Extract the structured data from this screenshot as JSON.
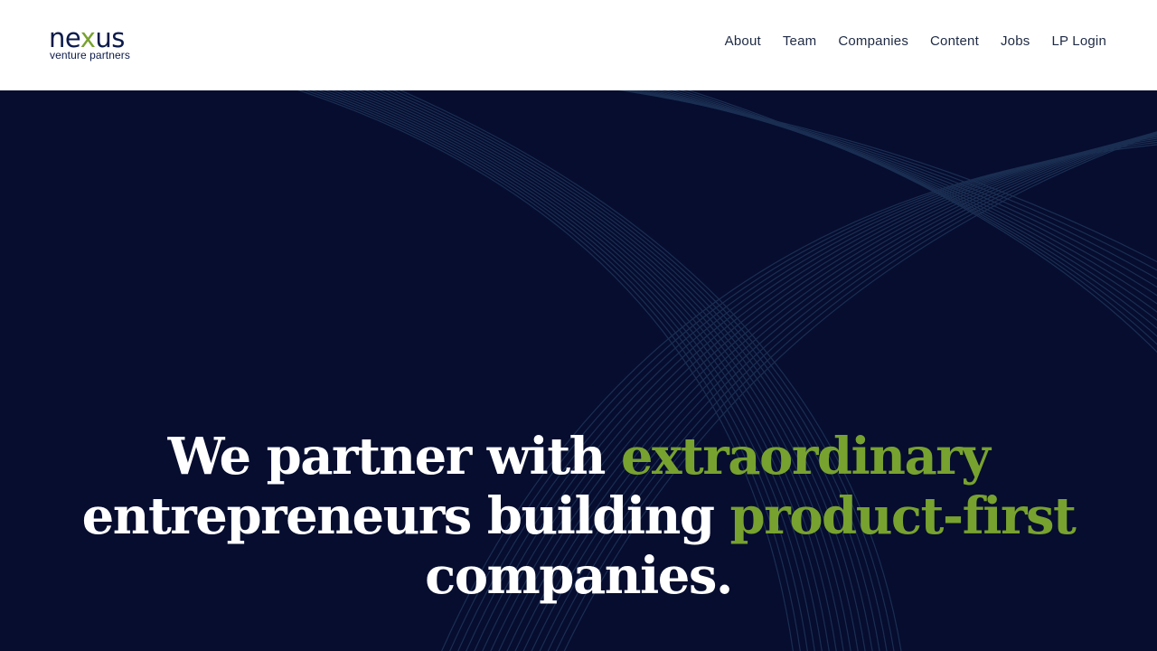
{
  "brand": {
    "logo_part1": "ne",
    "logo_x": "x",
    "logo_part2": "us",
    "tagline": "venture partners",
    "primary_color": "#0b1a4a",
    "accent_color": "#78a22f"
  },
  "nav": {
    "items": [
      {
        "label": "About"
      },
      {
        "label": "Team"
      },
      {
        "label": "Companies"
      },
      {
        "label": "Content"
      },
      {
        "label": "Jobs"
      },
      {
        "label": "LP Login"
      }
    ]
  },
  "hero": {
    "background_color": "#060d2f",
    "line_color": "#2b4a6f",
    "headline": {
      "part1": "We partner with ",
      "accent1": "extraordinary",
      "part2": "entrepreneurs building ",
      "accent2": "product-first",
      "part3": "companies."
    }
  }
}
